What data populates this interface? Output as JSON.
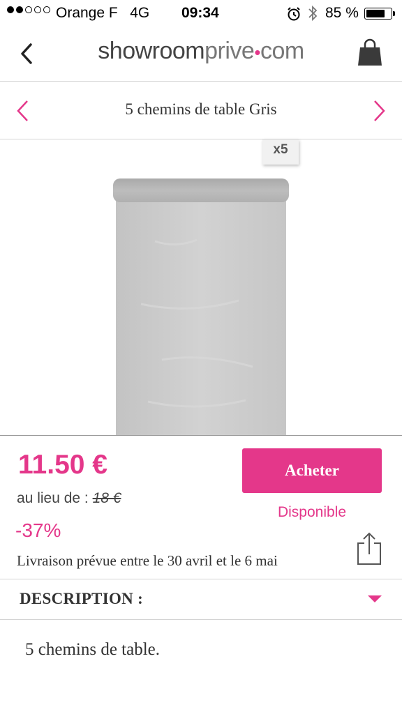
{
  "status_bar": {
    "carrier": "Orange F",
    "network": "4G",
    "time": "09:34",
    "battery": "85 %",
    "battery_level": 0.85,
    "signal_bars": 2,
    "icons": [
      "alarm-icon",
      "bluetooth-icon",
      "battery-icon"
    ]
  },
  "nav": {
    "logo_main": "showroom",
    "logo_sub": "prive",
    "logo_tld": "com",
    "icons": {
      "back": "chevron-left-icon",
      "cart": "shopping-bag-icon"
    }
  },
  "product": {
    "title": "5 chemins de table  Gris",
    "quantity_badge": "x5",
    "price": "11.50 €",
    "was_label": "au lieu de :",
    "was_price": "18 €",
    "discount": "-37%",
    "delivery": "Livraison prévue entre le 30 avril et le 6 mai",
    "buy_label": "Acheter",
    "availability": "Disponible",
    "image_color": "#c9c9c9"
  },
  "description": {
    "heading": "DESCRIPTION :",
    "text": "5 chemins de table."
  },
  "colors": {
    "accent": "#e4378a",
    "text": "#333333",
    "divider": "#d4d4d4"
  }
}
